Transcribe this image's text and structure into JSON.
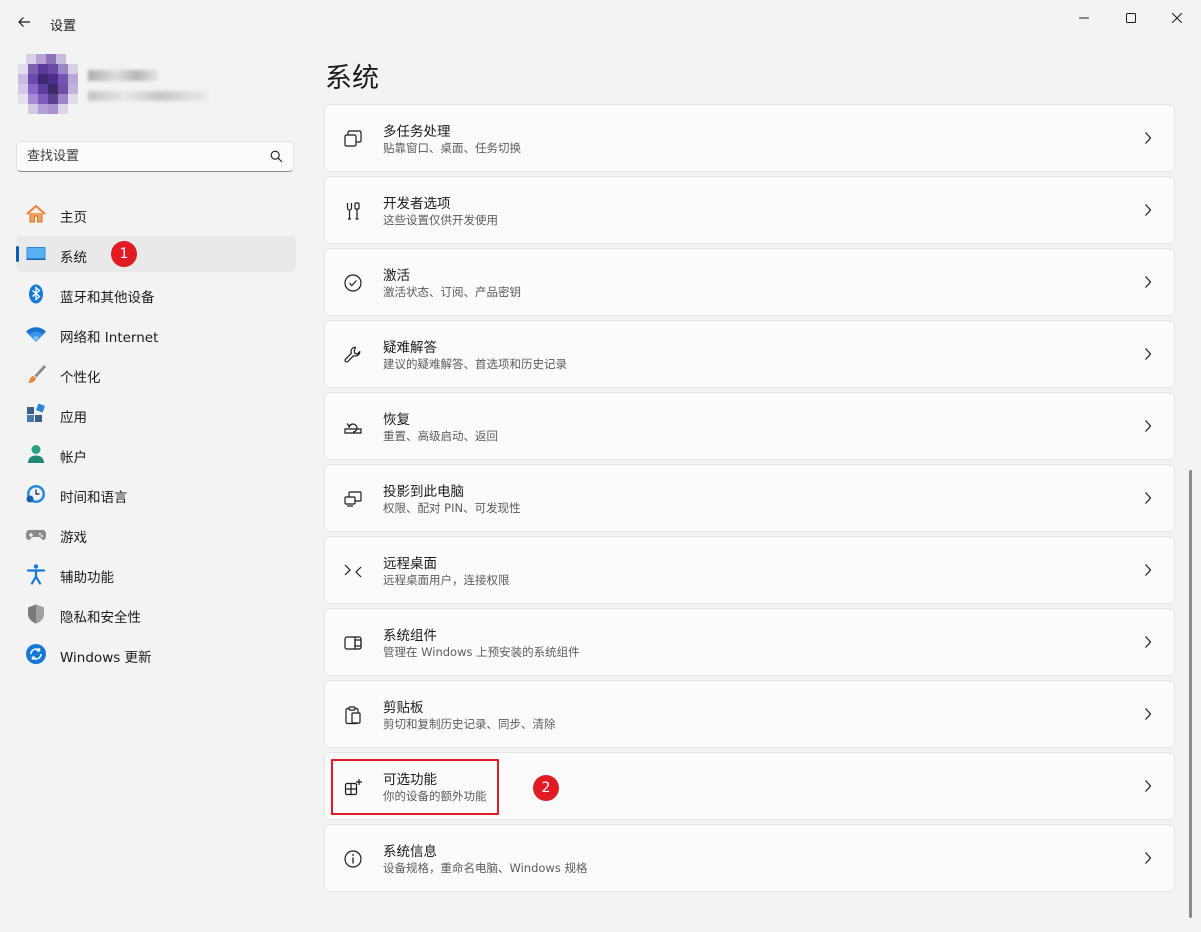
{
  "window": {
    "title": "设置"
  },
  "search": {
    "placeholder": "查找设置"
  },
  "sidebar": {
    "items": [
      {
        "label": "主页",
        "icon": "home-icon"
      },
      {
        "label": "系统",
        "icon": "system-icon",
        "active": true
      },
      {
        "label": "蓝牙和其他设备",
        "icon": "bluetooth-icon"
      },
      {
        "label": "网络和 Internet",
        "icon": "wifi-icon"
      },
      {
        "label": "个性化",
        "icon": "brush-icon"
      },
      {
        "label": "应用",
        "icon": "apps-icon"
      },
      {
        "label": "帐户",
        "icon": "account-icon"
      },
      {
        "label": "时间和语言",
        "icon": "time-language-icon"
      },
      {
        "label": "游戏",
        "icon": "gamepad-icon"
      },
      {
        "label": "辅助功能",
        "icon": "accessibility-icon"
      },
      {
        "label": "隐私和安全性",
        "icon": "shield-icon"
      },
      {
        "label": "Windows 更新",
        "icon": "update-icon"
      }
    ]
  },
  "annotations": {
    "badge1": "1",
    "badge2": "2"
  },
  "main": {
    "title": "系统",
    "cards": [
      {
        "title": "多任务处理",
        "subtitle": "贴靠窗口、桌面、任务切换",
        "icon": "multitasking-icon"
      },
      {
        "title": "开发者选项",
        "subtitle": "这些设置仅供开发使用",
        "icon": "developer-icon"
      },
      {
        "title": "激活",
        "subtitle": "激活状态、订阅、产品密钥",
        "icon": "activation-icon"
      },
      {
        "title": "疑难解答",
        "subtitle": "建议的疑难解答、首选项和历史记录",
        "icon": "wrench-icon"
      },
      {
        "title": "恢复",
        "subtitle": "重置、高级启动、返回",
        "icon": "recovery-icon"
      },
      {
        "title": "投影到此电脑",
        "subtitle": "权限、配对 PIN、可发现性",
        "icon": "projection-icon"
      },
      {
        "title": "远程桌面",
        "subtitle": "远程桌面用户，连接权限",
        "icon": "remote-desktop-icon"
      },
      {
        "title": "系统组件",
        "subtitle": "管理在 Windows 上预安装的系统组件",
        "icon": "system-components-icon"
      },
      {
        "title": "剪贴板",
        "subtitle": "剪切和复制历史记录、同步、清除",
        "icon": "clipboard-icon"
      },
      {
        "title": "可选功能",
        "subtitle": "你的设备的额外功能",
        "icon": "optional-features-icon"
      },
      {
        "title": "系统信息",
        "subtitle": "设备规格，重命名电脑、Windows 规格",
        "icon": "info-icon"
      }
    ]
  },
  "colors": {
    "accent": "#005fb8",
    "badge": "#e01b24",
    "highlight": "#e01b24"
  }
}
